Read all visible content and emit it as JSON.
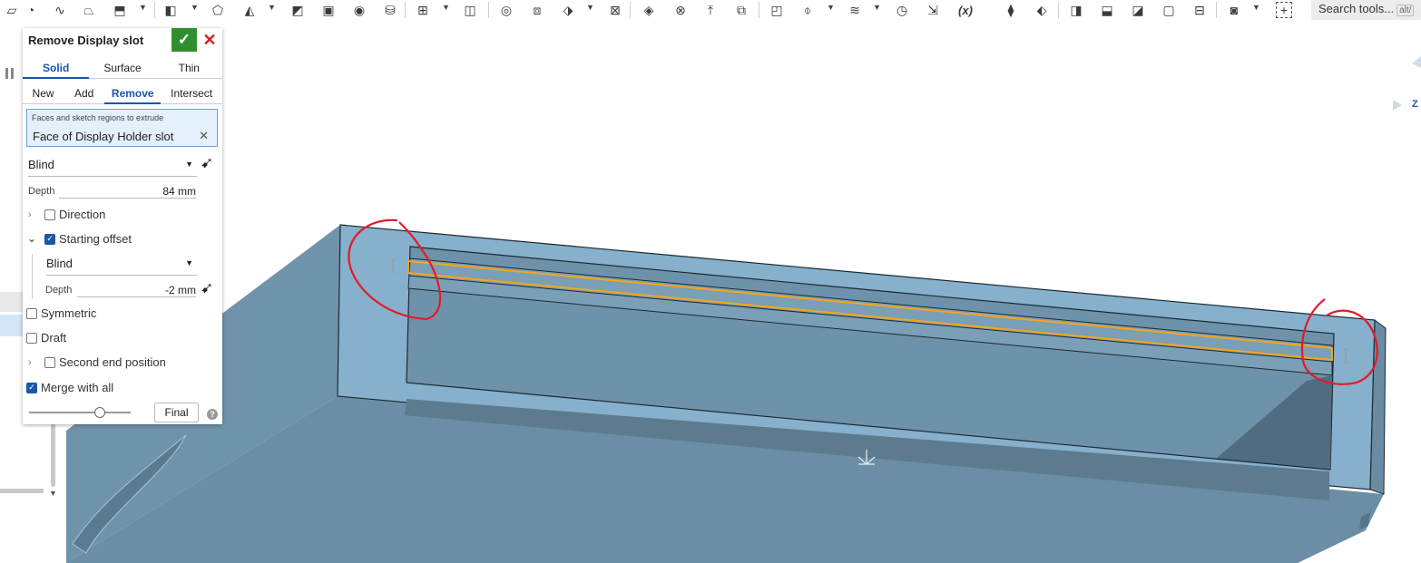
{
  "toolbar": {
    "search_placeholder": "Search tools...",
    "search_shortcut": "alt/",
    "variable_icon_label": "(x)"
  },
  "feature_dialog": {
    "title": "Remove Display slot",
    "type_tabs": [
      "Solid",
      "Surface",
      "Thin"
    ],
    "active_type_tab": "Solid",
    "operation_tabs": [
      "New",
      "Add",
      "Remove",
      "Intersect"
    ],
    "active_operation_tab": "Remove",
    "faces_label": "Faces and sketch regions to extrude",
    "faces_value": "Face of Display Holder slot",
    "end_type": "Blind",
    "depth_label": "Depth",
    "depth_value": "84 mm",
    "direction_label": "Direction",
    "direction_checked": false,
    "starting_offset_label": "Starting offset",
    "starting_offset_checked": true,
    "offset_type": "Blind",
    "offset_depth_label": "Depth",
    "offset_depth_value": "-2 mm",
    "symmetric_label": "Symmetric",
    "draft_label": "Draft",
    "second_end_label": "Second end position",
    "merge_label": "Merge with all",
    "merge_checked": true,
    "final_label": "Final"
  },
  "viewport": {
    "axis_label": "Z",
    "model_colors": {
      "face_light": "#86b0cb",
      "face_mid": "#6f93ab",
      "face_dark": "#5a7a8f",
      "selection": "#f5a51c",
      "annotation": "#e21b2a"
    }
  }
}
